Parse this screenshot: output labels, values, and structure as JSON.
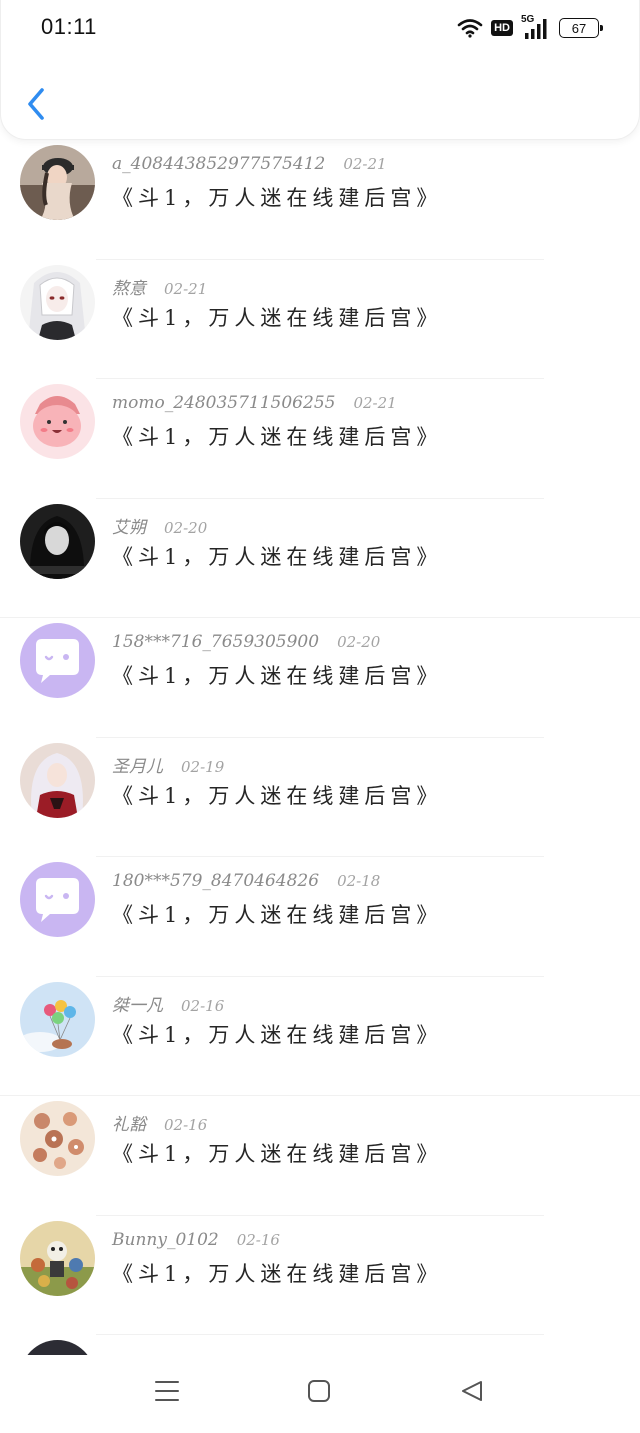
{
  "status_bar": {
    "time": "01:11",
    "hd": "HD",
    "network": "5G",
    "battery": "67"
  },
  "icons": {
    "back": "chevron-left-icon",
    "wifi": "wifi-icon",
    "signal": "signal-icon",
    "menu": "menu-icon",
    "home": "home-icon",
    "nav_back": "triangle-back-icon"
  },
  "colors": {
    "back_accent": "#2f8cf0",
    "default_avatar": "#c9b6f2"
  },
  "comments": [
    {
      "username": "a_408443852977575412",
      "date": "02-21",
      "message": "《斗1，万人迷在线建后宫》",
      "avatar": "photo-girl-cap"
    },
    {
      "username": "熬意",
      "date": "02-21",
      "message": "《斗1，万人迷在线建后宫》",
      "avatar": "anime-white-hair"
    },
    {
      "username": "momo_248035711506255",
      "date": "02-21",
      "message": "《斗1，万人迷在线建后宫》",
      "avatar": "pink-blob"
    },
    {
      "username": "艾朔",
      "date": "02-20",
      "message": "《斗1，万人迷在线建后宫》",
      "avatar": "dark-portrait"
    },
    {
      "username": "158***716_7659305900",
      "date": "02-20",
      "message": "《斗1，万人迷在线建后宫》",
      "avatar": "default-chat"
    },
    {
      "username": "圣月儿",
      "date": "02-19",
      "message": "《斗1，万人迷在线建后宫》",
      "avatar": "anime-red-dress"
    },
    {
      "username": "180***579_8470464826",
      "date": "02-18",
      "message": "《斗1，万人迷在线建后宫》",
      "avatar": "default-chat"
    },
    {
      "username": "桀一凡",
      "date": "02-16",
      "message": "《斗1，万人迷在线建后宫》",
      "avatar": "balloons-sky"
    },
    {
      "username": "礼豁",
      "date": "02-16",
      "message": "《斗1，万人迷在线建后宫》",
      "avatar": "cookies"
    },
    {
      "username": "Bunny_0102",
      "date": "02-16",
      "message": "《斗1，万人迷在线建后宫》",
      "avatar": "cartoon-group"
    }
  ]
}
